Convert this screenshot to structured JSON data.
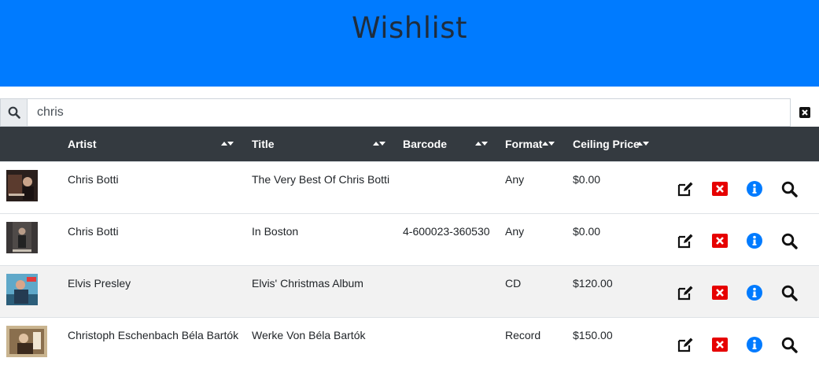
{
  "page": {
    "title": "Wishlist"
  },
  "search": {
    "value": "chris",
    "placeholder": ""
  },
  "table": {
    "columns": [
      {
        "key": "artist",
        "label": "Artist"
      },
      {
        "key": "title",
        "label": "Title"
      },
      {
        "key": "barcode",
        "label": "Barcode"
      },
      {
        "key": "format",
        "label": "Format"
      },
      {
        "key": "price",
        "label": "Ceiling Price"
      }
    ],
    "rows": [
      {
        "artist": "Chris Botti",
        "title": "The Very Best Of Chris Botti",
        "barcode": "",
        "format": "Any",
        "price": "$0.00"
      },
      {
        "artist": "Chris Botti",
        "title": "In Boston",
        "barcode": "4-600023-360530",
        "format": "Any",
        "price": "$0.00"
      },
      {
        "artist": "Elvis Presley",
        "title": "Elvis' Christmas Album",
        "barcode": "",
        "format": "CD",
        "price": "$120.00"
      },
      {
        "artist": "Christoph Eschenbach Béla Bartók",
        "title": "Werke Von Béla Bartók",
        "barcode": "",
        "format": "Record",
        "price": "$150.00"
      }
    ]
  },
  "icons": {
    "search": "search-icon",
    "clear": "close-square-icon",
    "sort": "sort-icon",
    "edit": "edit-icon",
    "delete": "delete-icon",
    "info": "info-icon",
    "lookup": "search-icon"
  },
  "colors": {
    "header_bg": "#007bff",
    "table_head_bg": "#343a40",
    "delete_red": "#e60000",
    "info_blue": "#007bff"
  }
}
